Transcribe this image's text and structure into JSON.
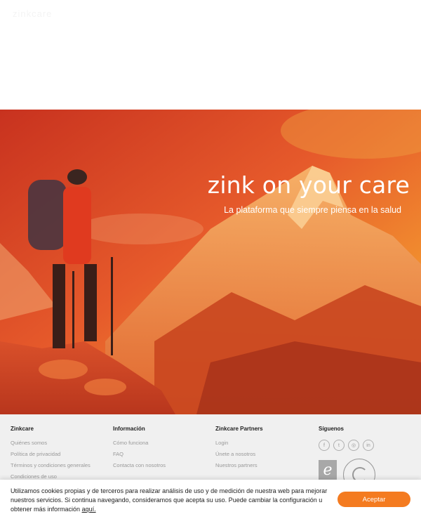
{
  "header": {
    "logo_text": "zinkcare"
  },
  "hero": {
    "title": "zink on your care",
    "subtitle": "La plataforma que siempre piensa en la salud"
  },
  "footer": {
    "columns": [
      {
        "title": "Zinkcare",
        "links": [
          "Quiénes somos",
          "Política de privacidad",
          "Términos y condiciones generales",
          "Condiciones de uso"
        ]
      },
      {
        "title": "Información",
        "links": [
          "Cómo funciona",
          "FAQ",
          "Contacta con nosotros"
        ]
      },
      {
        "title": "Zinkcare Partners",
        "links": [
          "Login",
          "Únete a nosotros",
          "Nuestros partners"
        ]
      },
      {
        "title": "Síguenos",
        "links": []
      }
    ],
    "social_icons": [
      "facebook-icon",
      "twitter-icon",
      "instagram-icon",
      "linkedin-icon"
    ],
    "social_glyphs": [
      "f",
      "t",
      "◎",
      "in"
    ]
  },
  "cookie_banner": {
    "text": "Utilizamos cookies propias y de terceros para realizar análisis de uso y de medición de nuestra web para mejorar nuestros servicios. Si continua navegando, consideramos que acepta su uso. Puede cambiar la configuración u obtener más información ",
    "link_text": "aquí.",
    "accept_label": "Aceptar",
    "accent_color": "#f47b20"
  }
}
